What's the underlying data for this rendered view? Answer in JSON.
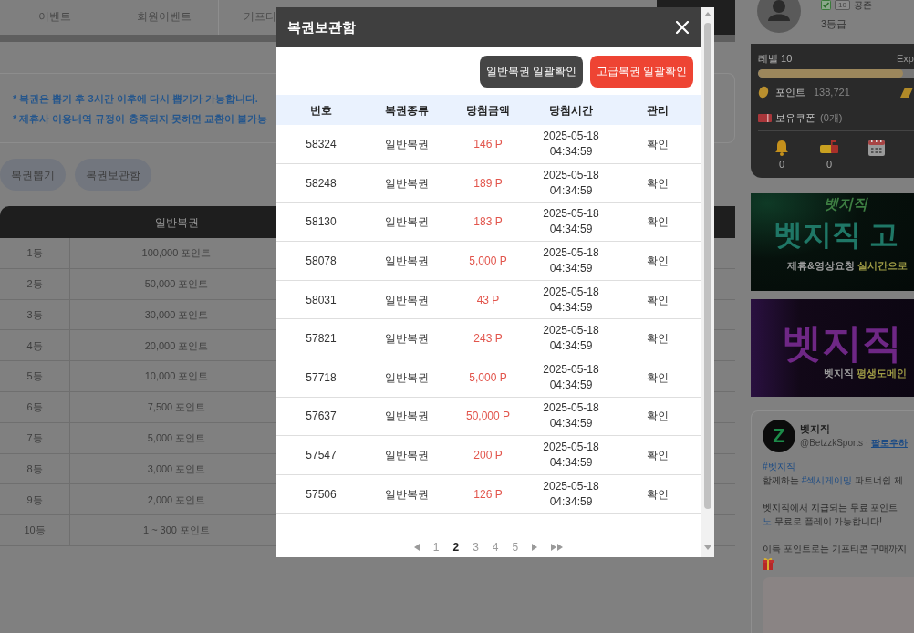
{
  "nav_tabs": [
    {
      "label": "이벤트",
      "selected": false
    },
    {
      "label": "회원이벤트",
      "selected": false
    },
    {
      "label": "기프티",
      "selected": false
    },
    {
      "selected": true
    }
  ],
  "notices": [
    "* 복권은 뽑기 후 3시간 이후에 다시 뽑기가 가능합니다.",
    "* 제휴사 이용내역 규정이 충족되지 못하면 교환이 불가능"
  ],
  "page_buttons": [
    {
      "label": "복권뽑기"
    },
    {
      "label": "복권보관함"
    }
  ],
  "prize_table": {
    "columns": [
      "일반복권"
    ],
    "rows": [
      {
        "rank": "1등",
        "prize": "100,000 포인트"
      },
      {
        "rank": "2등",
        "prize": "50,000 포인트"
      },
      {
        "rank": "3등",
        "prize": "30,000 포인트"
      },
      {
        "rank": "4등",
        "prize": "20,000 포인트"
      },
      {
        "rank": "5등",
        "prize": "10,000 포인트"
      },
      {
        "rank": "6등",
        "prize": "7,500 포인트"
      },
      {
        "rank": "7등",
        "prize": "5,000 포인트"
      },
      {
        "rank": "8등",
        "prize": "3,000 포인트"
      },
      {
        "rank": "9등",
        "prize": "2,000 포인트"
      },
      {
        "rank": "10등",
        "prize": "1 ~ 300 포인트"
      }
    ]
  },
  "profile": {
    "verified": true,
    "level_badge": "10",
    "name": "공존",
    "grade": "3등급"
  },
  "status_card": {
    "level_label": "레벨 10",
    "exp_label": "Exp",
    "level": 0.93,
    "points_label": "포인트",
    "points_value": "138,721",
    "coupons_label": "보유쿠폰",
    "coupons_value": "(0개)",
    "shortcuts": [
      {
        "kind": "bell",
        "count": "0"
      },
      {
        "kind": "mailbox",
        "count": "0"
      },
      {
        "kind": "calendar"
      }
    ]
  },
  "banners": [
    {
      "kind": "green",
      "title": "벳지직",
      "headline": "벳지직 고",
      "subtitle": [
        {
          "text": "제휴&영상요청",
          "accent": false
        },
        {
          "text": "실시간으로",
          "accent": true
        }
      ]
    },
    {
      "kind": "purple",
      "headline": "벳지직",
      "subtitle": [
        {
          "text": "벳지직",
          "accent": false
        },
        {
          "text": "평생도메인",
          "accent": true
        }
      ]
    }
  ],
  "tweet": {
    "logo_text": "Z",
    "author": "벳지직",
    "handle": "@BetzzkSports",
    "separator": "·",
    "follow": "팔로우하",
    "paragraphs": [
      [
        [
          {
            "text": "#벳지직",
            "kind": "link"
          }
        ],
        [
          {
            "text": "함께하는 ",
            "kind": "plain"
          },
          {
            "text": "#섹시게이밍",
            "kind": "link"
          },
          {
            "text": " 파트너쉽 체",
            "kind": "plain"
          }
        ]
      ],
      [
        [
          {
            "text": "벳지직에서 지급되는 무료 포인트",
            "kind": "plain"
          }
        ],
        [
          {
            "text": "노",
            "kind": "link"
          },
          {
            "text": " 무료로 플레이 가능합니다!",
            "kind": "plain"
          }
        ]
      ],
      [
        [
          {
            "text": "이득 포인트로는 기프티콘 구매까지",
            "kind": "plain"
          }
        ]
      ]
    ]
  },
  "modal": {
    "title": "복권보관함",
    "actions": [
      {
        "label": "일반복권 일괄확인",
        "kind": "dark"
      },
      {
        "label": "고급복권 일괄확인",
        "kind": "red"
      }
    ],
    "columns": [
      "번호",
      "복권종류",
      "당첨금액",
      "당첨시간",
      "관리"
    ],
    "rows": [
      {
        "id": "58324",
        "type": "일반복권",
        "amount": "146 P",
        "date": "2025-05-18",
        "time": "04:34:59",
        "action": "확인"
      },
      {
        "id": "58248",
        "type": "일반복권",
        "amount": "189 P",
        "date": "2025-05-18",
        "time": "04:34:59",
        "action": "확인"
      },
      {
        "id": "58130",
        "type": "일반복권",
        "amount": "183 P",
        "date": "2025-05-18",
        "time": "04:34:59",
        "action": "확인"
      },
      {
        "id": "58078",
        "type": "일반복권",
        "amount": "5,000 P",
        "date": "2025-05-18",
        "time": "04:34:59",
        "action": "확인"
      },
      {
        "id": "58031",
        "type": "일반복권",
        "amount": "43 P",
        "date": "2025-05-18",
        "time": "04:34:59",
        "action": "확인"
      },
      {
        "id": "57821",
        "type": "일반복권",
        "amount": "243 P",
        "date": "2025-05-18",
        "time": "04:34:59",
        "action": "확인"
      },
      {
        "id": "57718",
        "type": "일반복권",
        "amount": "5,000 P",
        "date": "2025-05-18",
        "time": "04:34:59",
        "action": "확인"
      },
      {
        "id": "57637",
        "type": "일반복권",
        "amount": "50,000 P",
        "date": "2025-05-18",
        "time": "04:34:59",
        "action": "확인"
      },
      {
        "id": "57547",
        "type": "일반복권",
        "amount": "200 P",
        "date": "2025-05-18",
        "time": "04:34:59",
        "action": "확인"
      },
      {
        "id": "57506",
        "type": "일반복권",
        "amount": "126 P",
        "date": "2025-05-18",
        "time": "04:34:59",
        "action": "확인"
      }
    ],
    "pagination": {
      "pages": [
        {
          "label": "1",
          "selected": false
        },
        {
          "label": "2",
          "selected": true
        },
        {
          "label": "3",
          "selected": false
        },
        {
          "label": "4",
          "selected": false
        },
        {
          "label": "5",
          "selected": false
        }
      ]
    }
  }
}
